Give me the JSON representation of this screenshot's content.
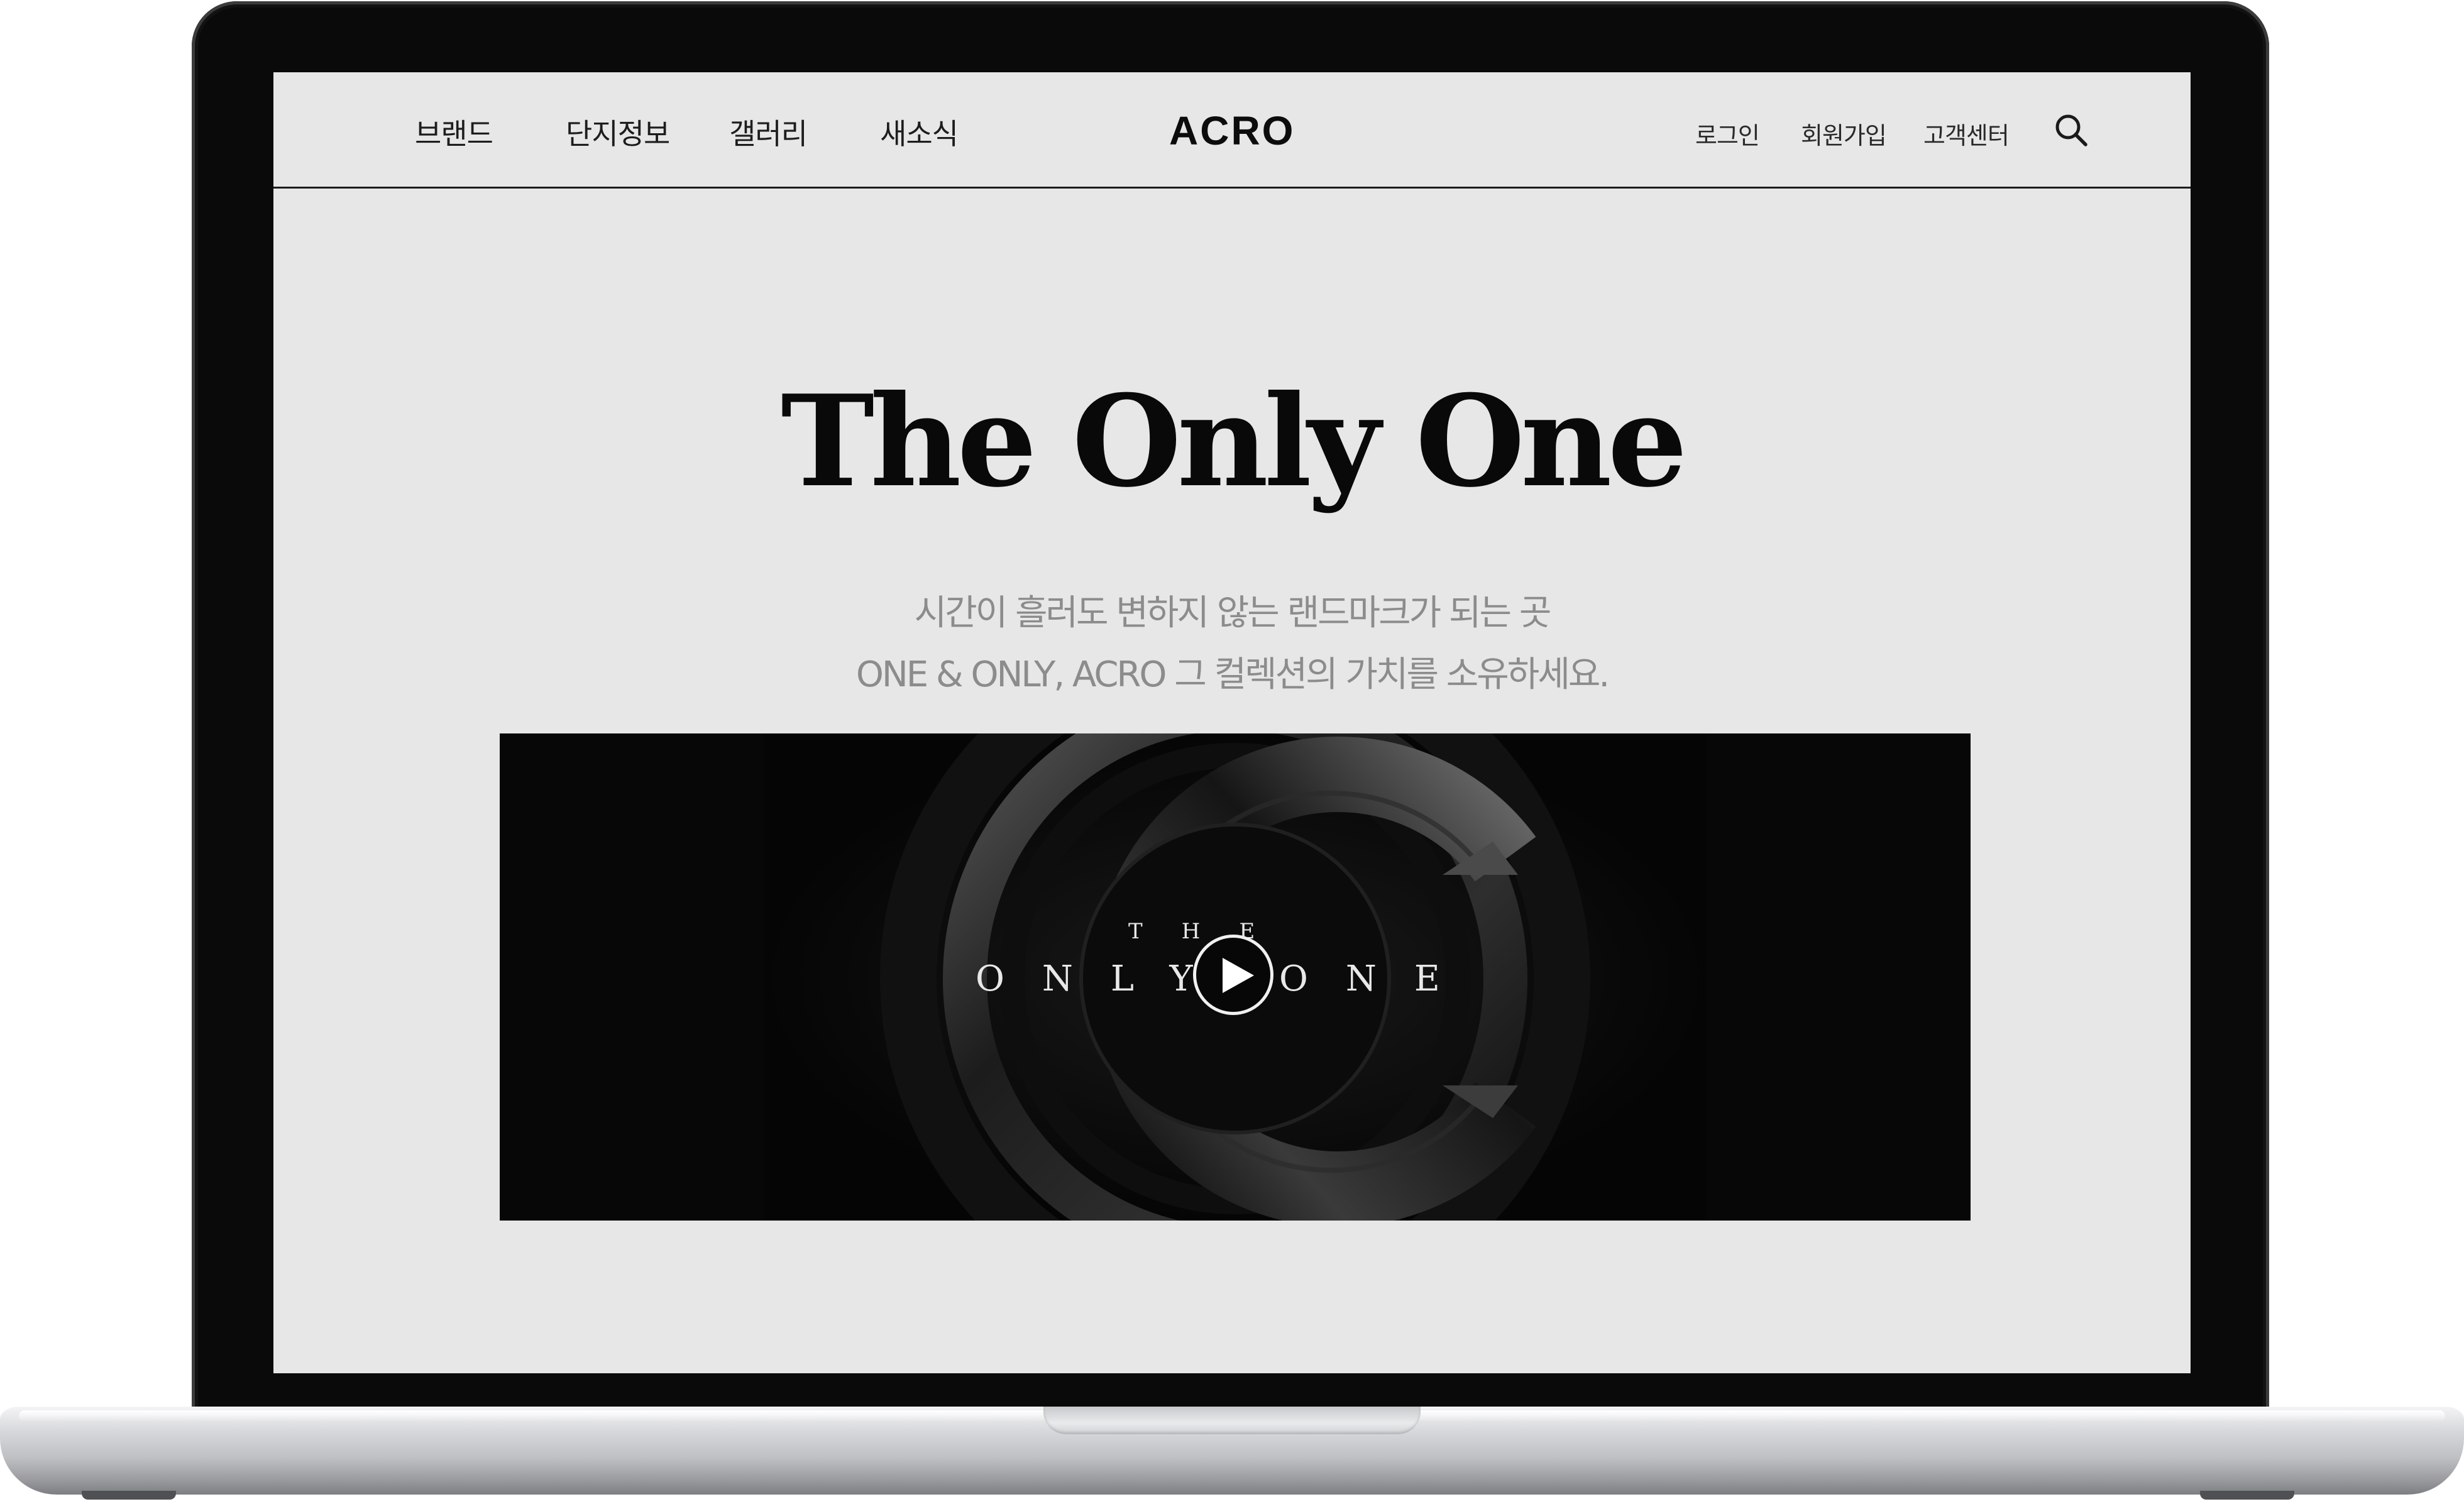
{
  "header": {
    "nav": [
      "브랜드",
      "단지정보",
      "갤러리",
      "새소식"
    ],
    "logo": "ACRO",
    "utility": {
      "login": "로그인",
      "signup": "회원가입",
      "support": "고객센터"
    },
    "search_icon": "search-icon"
  },
  "hero": {
    "title": "The Only One",
    "subtitle_line1": "시간이 흘러도 변하지 않는 랜드마크가 되는 곳",
    "subtitle_line2": "ONE & ONLY, ACRO 그 컬렉션의 가치를 소유하세요."
  },
  "video": {
    "overlay_top": "THE",
    "overlay_left": "ONLY",
    "overlay_right": "ONE",
    "play_icon": "play-icon"
  },
  "colors": {
    "page_background": "#e7e7e7",
    "text_primary": "#0c0c0c",
    "text_muted": "#8c8c8c",
    "video_background": "#070707",
    "bezel": "#0a0a0a",
    "chassis": "#c4c5c9"
  }
}
